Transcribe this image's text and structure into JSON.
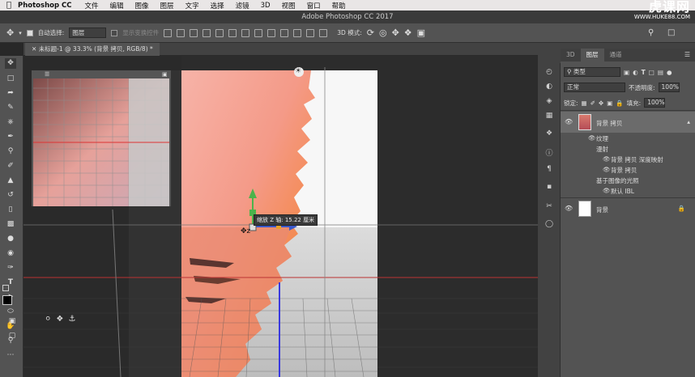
{
  "menubar": {
    "app": "Photoshop CC",
    "items": [
      "文件",
      "编辑",
      "图像",
      "图层",
      "文字",
      "选择",
      "滤镜",
      "3D",
      "视图",
      "窗口",
      "帮助"
    ]
  },
  "window": {
    "title": "Adobe Photoshop CC 2017"
  },
  "watermark": {
    "brand": "虎课网",
    "url": "WWW.HUKE88.COM"
  },
  "options": {
    "auto_select_label": "自动选择:",
    "auto_select_value": "图层",
    "transform_label": "显示变换控件",
    "mode_3d_label": "3D 模式:"
  },
  "document": {
    "tab_title": "未标题-1 @ 33.3% (背景 拷贝, RGB/8) *"
  },
  "tooltip": {
    "text": "缩放 Z 轴: 15.22 厘米"
  },
  "panels": {
    "tabs": [
      "3D",
      "图层",
      "通道"
    ],
    "active_tab": "图层",
    "filter_kind": "类型",
    "blend_mode": "正常",
    "opacity_label": "不透明度:",
    "opacity_value": "100%",
    "lock_label": "锁定:",
    "fill_label": "填充:",
    "fill_value": "100%",
    "layers": [
      {
        "name": "背景 拷贝",
        "visible": true,
        "selected": true
      },
      {
        "name": "纹理",
        "indent": 1
      },
      {
        "name": "漫射",
        "indent": 2
      },
      {
        "name": "背景 拷贝 深度映射",
        "indent": 3,
        "visible": true
      },
      {
        "name": "背景 拷贝",
        "indent": 3,
        "visible": true
      },
      {
        "name": "基于图像的光照",
        "indent": 2
      },
      {
        "name": "默认 IBL",
        "indent": 3,
        "visible": true
      },
      {
        "name": "背景",
        "visible": true,
        "locked": true
      }
    ]
  },
  "colors": {
    "accent": "#4e7fc6",
    "sky_pink": "#f4a392",
    "orange": "#f0893f",
    "foreground": "#000000",
    "background": "#ffffff"
  }
}
